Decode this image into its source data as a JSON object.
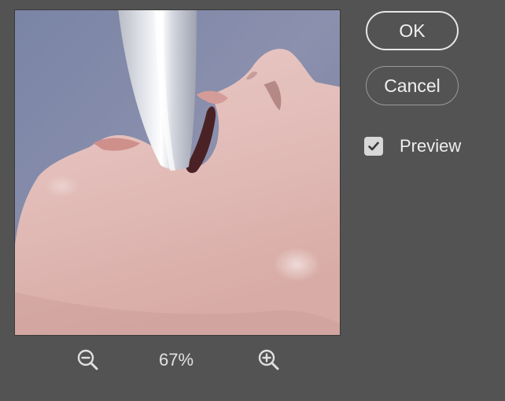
{
  "buttons": {
    "ok_label": "OK",
    "cancel_label": "Cancel"
  },
  "preview_toggle": {
    "label": "Preview",
    "checked": true
  },
  "zoom": {
    "level": "67%",
    "zoom_out_icon": "zoom-out-magnifier",
    "zoom_in_icon": "zoom-in-magnifier"
  },
  "colors": {
    "panel_background": "#535353",
    "button_border": "#e6e6e6",
    "checkbox_fill": "#d8d8d8"
  }
}
